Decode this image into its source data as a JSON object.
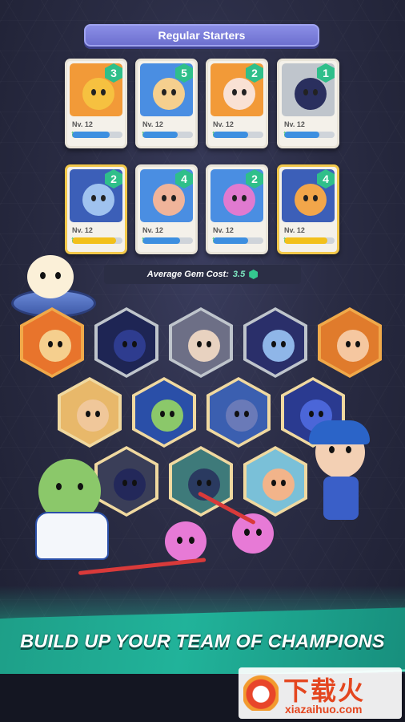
{
  "header": {
    "title": "Regular Starters"
  },
  "cards": [
    {
      "cost": "3",
      "level": "Nv. 12",
      "progress": 0.75,
      "art": "#f29a38",
      "face": "#f6c140",
      "bar": "blue"
    },
    {
      "cost": "5",
      "level": "Nv. 12",
      "progress": 0.7,
      "art": "#4a8ee2",
      "face": "#f5cf8e",
      "bar": "blue"
    },
    {
      "cost": "2",
      "level": "Nv. 12",
      "progress": 0.7,
      "art": "#f29a38",
      "face": "#f9e1d4",
      "bar": "blue"
    },
    {
      "cost": "1",
      "level": "Nv. 12",
      "progress": 0.7,
      "art": "#bfc5cc",
      "face": "#2a2f5e",
      "bar": "blue"
    },
    {
      "cost": "2",
      "level": "Nv. 12",
      "progress": 0.88,
      "art": "#3c5fb8",
      "face": "#9fc2ef",
      "bar": "yellow",
      "gold": true
    },
    {
      "cost": "4",
      "level": "Nv. 12",
      "progress": 0.75,
      "art": "#4a8ee2",
      "face": "#f0b49a",
      "bar": "blue"
    },
    {
      "cost": "2",
      "level": "Nv. 12",
      "progress": 0.7,
      "art": "#4a8ee2",
      "face": "#e07ad0",
      "bar": "blue"
    },
    {
      "cost": "4",
      "level": "Nv. 12",
      "progress": 0.85,
      "art": "#3c5fb8",
      "face": "#f2a64a",
      "bar": "yellow",
      "gold": true
    }
  ],
  "average_gem_cost": {
    "label": "Average Gem Cost:",
    "value": "3.5"
  },
  "champions": [
    {
      "bg": "#e8742c",
      "face": "#f5cf8e",
      "frame": "#f0a94a"
    },
    {
      "bg": "#1e2554",
      "face": "#2e3c8f",
      "frame": "#bfc5cc"
    },
    {
      "bg": "#6d6f86",
      "face": "#e8d2c0",
      "frame": "#bfc5cc"
    },
    {
      "bg": "#2a2f6a",
      "face": "#8fb6e8",
      "frame": "#bfc5cc"
    },
    {
      "bg": "#e07b2c",
      "face": "#f5c7a0",
      "frame": "#f0a94a"
    },
    {
      "bg": "#e8b86a",
      "face": "#f0c79a",
      "frame": "#f0d9a0"
    },
    {
      "bg": "#2a4fa8",
      "face": "#8bc86a",
      "frame": "#f0d9a0"
    },
    {
      "bg": "#3b5fb0",
      "face": "#6a7ab8",
      "frame": "#f0d9a0"
    },
    {
      "bg": "#2a3a90",
      "face": "#4b66d8",
      "frame": "#f0d9a0"
    },
    {
      "bg": "#3a3e58",
      "face": "#23285a",
      "frame": "#f0d9a0"
    },
    {
      "bg": "#3e7a7a",
      "face": "#2a3a60",
      "frame": "#f0d9a0"
    },
    {
      "bg": "#7ac0d8",
      "face": "#f2b48a",
      "frame": "#f0d9a0"
    }
  ],
  "banner": {
    "headline": "BUILD UP YOUR TEAM OF CHAMPIONS"
  },
  "watermark": {
    "title": "下载火",
    "url": "xiazaihuo.com"
  }
}
